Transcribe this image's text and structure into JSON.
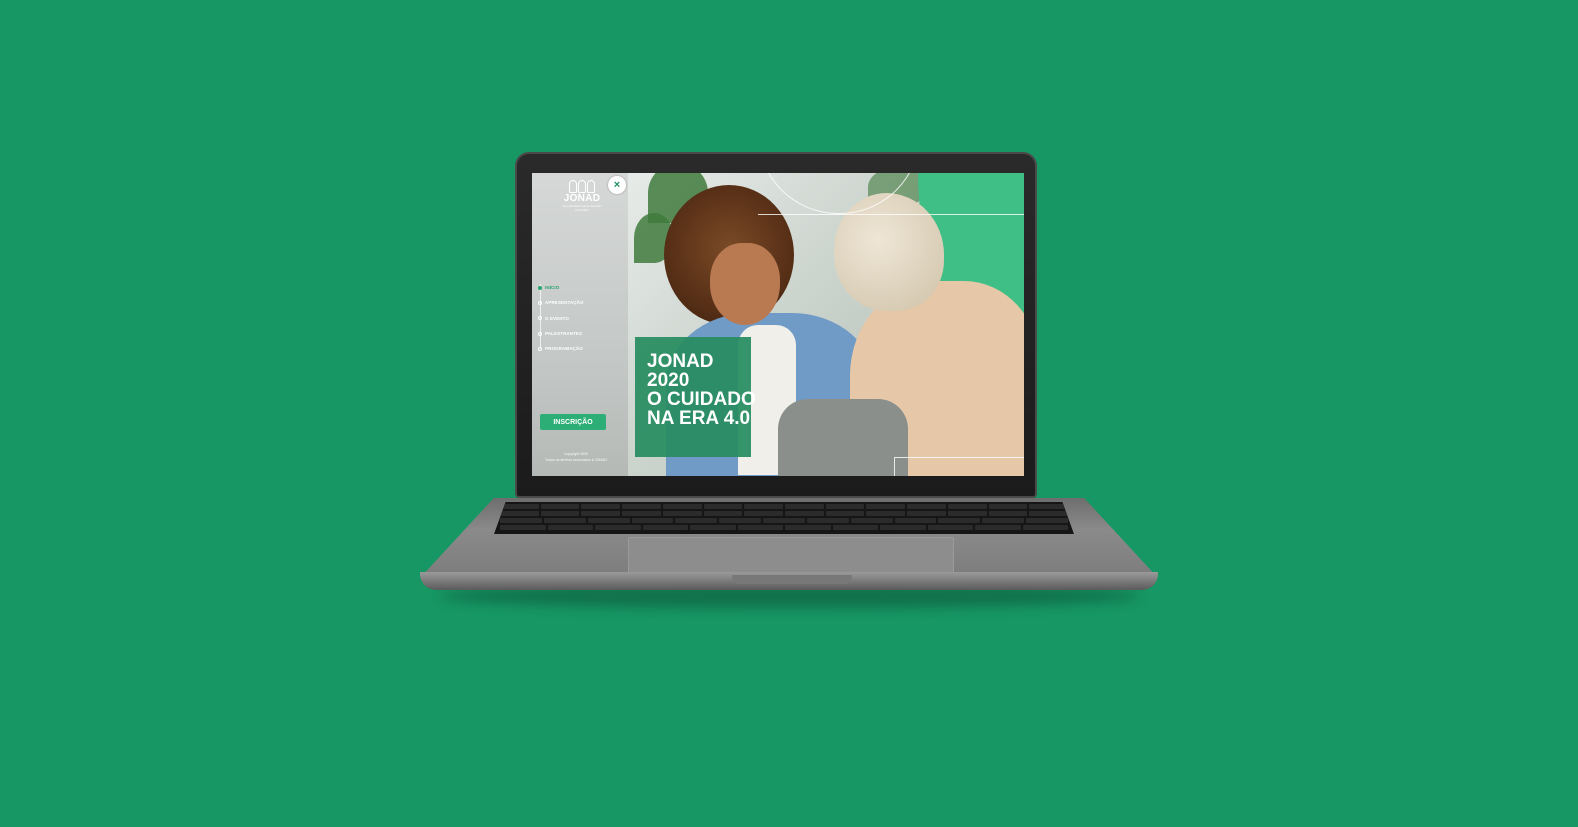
{
  "colors": {
    "background": "#169763",
    "accent": "#2aa371"
  },
  "site": {
    "logo": {
      "title": "JONAD",
      "subtitle": "Jornada Nacional de Atenção Domiciliar"
    },
    "close_icon": "×",
    "menu": [
      {
        "label": "INÍCIO",
        "active": true
      },
      {
        "label": "APRESENTAÇÃO",
        "active": false
      },
      {
        "label": "O EVENTO",
        "active": false
      },
      {
        "label": "PALESTRANTES",
        "active": false
      },
      {
        "label": "PROGRAMAÇÃO",
        "active": false
      }
    ],
    "cta_label": "INSCRIÇÃO",
    "copyright": [
      "Copyright 2020",
      "Todos os direitos reservados à JONAD"
    ],
    "hero_title": [
      "JONAD",
      "2020",
      "O CUIDADO",
      "NA ERA 4.0"
    ]
  }
}
